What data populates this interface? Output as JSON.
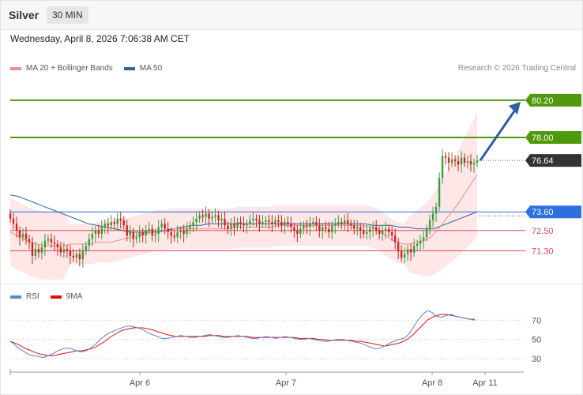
{
  "header": {
    "asset": "Silver",
    "interval": "30 MIN"
  },
  "datetime": "Wednesday, April 8, 2026 7:06:38 AM CET",
  "copyright": "Research © 2026 Trading Central",
  "legend_top": [
    {
      "label": "MA 20 + Bollinger Bands",
      "color": "#f28c8c"
    },
    {
      "label": "MA 50",
      "color": "#34609a"
    }
  ],
  "legend_bottom": [
    {
      "label": "RSI",
      "color": "#5b82d9"
    },
    {
      "label": "9MA",
      "color": "#e01010"
    }
  ],
  "colors": {
    "resistance": "#4f9a0c",
    "pivot": "#2e6fe0",
    "support": "#e04a55",
    "last": "#333333",
    "up_candle": "#3b9a3b",
    "down_candle": "#d02020",
    "bb_fill": "#fde3e3",
    "arrow": "#2f5f9e"
  },
  "chart_data": [
    {
      "type": "candlestick",
      "title": "Silver",
      "x_ticks": [
        "Apr 6",
        "Apr 7",
        "Apr 8",
        "Apr 11"
      ],
      "levels": [
        {
          "label": "80.20",
          "value": 80.2,
          "kind": "resistance"
        },
        {
          "label": "78.00",
          "value": 78.0,
          "kind": "resistance"
        },
        {
          "label": "76.64",
          "value": 76.64,
          "kind": "last"
        },
        {
          "label": "73.60",
          "value": 73.6,
          "kind": "pivot"
        },
        {
          "label": "72.50",
          "value": 72.5,
          "kind": "support"
        },
        {
          "label": "71.30",
          "value": 71.3,
          "kind": "support"
        }
      ],
      "close": [
        73.2,
        72.9,
        72.5,
        72.1,
        72.3,
        72.0,
        71.8,
        71.0,
        71.4,
        71.2,
        71.5,
        71.9,
        72.0,
        71.8,
        71.7,
        71.5,
        71.2,
        71.4,
        71.3,
        71.0,
        70.9,
        71.1,
        70.8,
        71.3,
        71.6,
        72.0,
        72.3,
        72.5,
        72.3,
        72.7,
        72.9,
        72.8,
        73.0,
        72.9,
        73.2,
        73.1,
        72.8,
        72.2,
        72.4,
        72.0,
        72.1,
        72.4,
        72.2,
        72.5,
        72.6,
        72.2,
        72.3,
        72.7,
        72.9,
        72.6,
        72.4,
        72.2,
        72.1,
        72.4,
        72.5,
        72.3,
        72.6,
        72.8,
        73.0,
        73.2,
        73.4,
        73.3,
        73.5,
        73.2,
        73.3,
        73.4,
        73.1,
        73.2,
        72.8,
        72.6,
        72.9,
        72.7,
        73.0,
        72.9,
        72.8,
        72.9,
        73.1,
        73.2,
        73.1,
        72.9,
        73.0,
        73.1,
        73.0,
        72.9,
        73.1,
        73.0,
        72.8,
        73.0,
        72.9,
        72.7,
        72.5,
        72.3,
        72.6,
        72.8,
        72.7,
        72.9,
        73.0,
        72.8,
        72.5,
        72.7,
        72.6,
        72.4,
        72.8,
        72.9,
        73.0,
        72.9,
        73.1,
        72.9,
        72.8,
        72.6,
        72.7,
        72.5,
        72.3,
        72.4,
        72.6,
        72.7,
        72.5,
        72.3,
        72.5,
        72.6,
        72.4,
        72.2,
        71.8,
        71.3,
        70.9,
        71.1,
        71.4,
        71.2,
        71.6,
        71.7,
        71.9,
        72.1,
        72.6,
        73.1,
        73.5,
        73.9,
        75.6,
        76.9,
        76.8,
        76.5,
        76.7,
        76.6,
        76.4,
        76.8,
        76.5,
        76.6,
        76.4,
        76.5,
        76.64
      ],
      "ma20": [
        72.4,
        72.2,
        72.0,
        71.8,
        71.7,
        71.6,
        71.6,
        71.6,
        71.6,
        71.7,
        71.7,
        71.7,
        71.7,
        71.8,
        71.8,
        71.8,
        71.9,
        72.0,
        72.1,
        72.2,
        72.3,
        72.4,
        72.5,
        72.5,
        72.6,
        72.6,
        72.6,
        72.6,
        72.6,
        72.6,
        72.6,
        72.6,
        72.6,
        72.6,
        72.7,
        72.7,
        72.7,
        72.7,
        72.7,
        72.7,
        72.8,
        72.8,
        72.8,
        72.8,
        72.8,
        72.8,
        72.8,
        72.8,
        72.8,
        72.8,
        72.8,
        72.8,
        72.8,
        72.8,
        72.7,
        72.6,
        72.3,
        72.0,
        71.8,
        71.7,
        71.7,
        71.8,
        71.9,
        72.1,
        72.5,
        73.0,
        73.5,
        74.0,
        74.6,
        75.2,
        75.8
      ],
      "ma50": [
        74.6,
        74.5,
        74.3,
        74.1,
        73.9,
        73.7,
        73.5,
        73.3,
        73.1,
        72.9,
        72.8,
        72.7,
        72.6,
        72.5,
        72.4,
        72.4,
        72.4,
        72.4,
        72.5,
        72.6,
        72.7,
        72.8,
        72.8,
        72.9,
        72.9,
        72.9,
        72.9,
        72.9,
        72.9,
        72.9,
        72.9,
        72.9,
        72.9,
        72.9,
        72.9,
        72.9,
        72.9,
        72.9,
        72.9,
        72.9,
        72.9,
        72.9,
        72.8,
        72.8,
        72.8,
        72.7,
        72.7,
        72.6,
        72.6,
        72.6,
        72.8,
        73.0,
        73.2,
        73.4,
        73.6
      ],
      "y_range": [
        69.5,
        81.5
      ]
    },
    {
      "type": "line",
      "series": [
        {
          "name": "RSI",
          "values": [
            48,
            44,
            40,
            37,
            34,
            33,
            32,
            31,
            33,
            35,
            38,
            40,
            41,
            40,
            38,
            37,
            38,
            41,
            45,
            50,
            54,
            57,
            59,
            61,
            63,
            64,
            63,
            62,
            60,
            57,
            55,
            53,
            51,
            51,
            52,
            53,
            54,
            53,
            52,
            52,
            53,
            54,
            55,
            54,
            53,
            52,
            52,
            53,
            54,
            53,
            52,
            51,
            51,
            52,
            53,
            52,
            51,
            52,
            53,
            52,
            51,
            50,
            50,
            51,
            50,
            49,
            48,
            48,
            49,
            50,
            50,
            49,
            48,
            47,
            46,
            44,
            42,
            40,
            41,
            43,
            46,
            48,
            50,
            51,
            55,
            62,
            70,
            76,
            80,
            78,
            74,
            73,
            75,
            76,
            74,
            73,
            72,
            71,
            70
          ]
        },
        {
          "name": "9MA",
          "values": [
            48,
            46,
            44,
            41,
            39,
            37,
            35,
            34,
            33,
            33,
            34,
            35,
            36,
            37,
            38,
            38,
            39,
            40,
            42,
            45,
            48,
            52,
            55,
            58,
            60,
            61,
            62,
            62,
            62,
            61,
            60,
            58,
            57,
            55,
            54,
            53,
            53,
            53,
            53,
            53,
            53,
            53,
            54,
            54,
            54,
            53,
            53,
            53,
            53,
            53,
            53,
            52,
            52,
            52,
            52,
            52,
            52,
            52,
            52,
            52,
            52,
            51,
            51,
            51,
            51,
            50,
            50,
            49,
            49,
            49,
            49,
            49,
            49,
            48,
            48,
            47,
            46,
            45,
            44,
            43,
            44,
            45,
            46,
            48,
            51,
            55,
            60,
            65,
            70,
            73,
            75,
            76,
            76,
            75,
            74,
            73,
            72,
            71,
            71
          ]
        }
      ],
      "y_ticks": [
        70,
        50,
        30
      ],
      "y_range": [
        20,
        90
      ]
    }
  ]
}
